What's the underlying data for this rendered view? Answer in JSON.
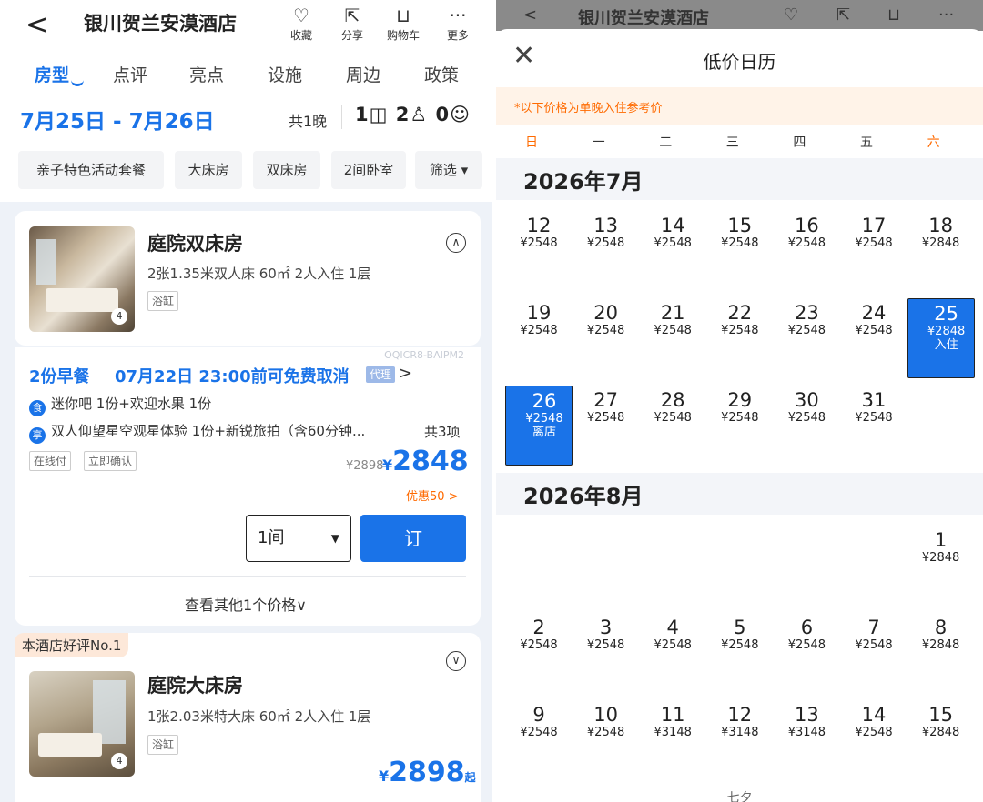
{
  "left": {
    "header": {
      "back": "<",
      "title": "银川贺兰安漠酒店",
      "actions": [
        {
          "icon": "heart-icon",
          "glyph": "♡",
          "label": "收藏"
        },
        {
          "icon": "share-icon",
          "glyph": "⇱",
          "label": "分享"
        },
        {
          "icon": "cart-icon",
          "glyph": "🛒",
          "label": "购物车"
        },
        {
          "icon": "more-icon",
          "glyph": "···",
          "label": "更多"
        }
      ]
    },
    "tabs": [
      "房型",
      "点评",
      "亮点",
      "设施",
      "周边",
      "政策"
    ],
    "dates": "7月25日 - 7月26日",
    "nights": "共1晚",
    "guests": "1 2 0",
    "chips": [
      "亲子特色活动套餐",
      "大床房",
      "双床房",
      "2间卧室",
      "筛选 ▾"
    ],
    "room1": {
      "name": "庭院双床房",
      "desc": "2张1.35米双人床 60㎡ 2人入住 1层",
      "tag": "浴缸",
      "img_count": "4",
      "code": "OQICR8-BAIPM2",
      "breakfast": "2份早餐",
      "cancel": "07月22日 23:00前可免费取消",
      "agent": "代理",
      "agent_arrow": ">",
      "perk1_icon": "食",
      "perk1": "迷你吧 1份+欢迎水果 1份",
      "perk2_icon": "享",
      "perk2": "双人仰望星空观星体验 1份+新锐旅拍（含60分钟...",
      "perk_total": "共3项",
      "tags": [
        "在线付",
        "立即确认"
      ],
      "old_price": "¥2898",
      "currency": "¥",
      "price": "2848",
      "discount": "优惠50 >",
      "qty": "1间",
      "book": "订",
      "more_prices": "查看其他1个价格∨"
    },
    "room2": {
      "badge": "本酒店好评No.1",
      "name": "庭院大床房",
      "desc": "1张2.03米特大床 60㎡ 2人入住 1层",
      "tag": "浴缸",
      "img_count": "4",
      "currency": "¥",
      "price": "2898",
      "suffix": "起"
    }
  },
  "right": {
    "bg_title": "银川贺兰安漠酒店",
    "title": "低价日历",
    "notice": "*以下价格为单晚入住参考价",
    "weekdays": [
      "日",
      "一",
      "二",
      "三",
      "四",
      "五",
      "六"
    ],
    "months": [
      {
        "label": "2026年7月",
        "rows": [
          [
            {
              "d": "12",
              "p": "¥2548"
            },
            {
              "d": "13",
              "p": "¥2548"
            },
            {
              "d": "14",
              "p": "¥2548"
            },
            {
              "d": "15",
              "p": "¥2548"
            },
            {
              "d": "16",
              "p": "¥2548"
            },
            {
              "d": "17",
              "p": "¥2548"
            },
            {
              "d": "18",
              "p": "¥2848"
            }
          ],
          [
            {
              "d": "19",
              "p": "¥2548"
            },
            {
              "d": "20",
              "p": "¥2548"
            },
            {
              "d": "21",
              "p": "¥2548"
            },
            {
              "d": "22",
              "p": "¥2548"
            },
            {
              "d": "23",
              "p": "¥2548"
            },
            {
              "d": "24",
              "p": "¥2548"
            },
            {
              "d": "25",
              "p": "¥2848",
              "note": "入住",
              "selected": true
            }
          ],
          [
            {
              "d": "26",
              "p": "¥2548",
              "note": "离店",
              "selected": true
            },
            {
              "d": "27",
              "p": "¥2548"
            },
            {
              "d": "28",
              "p": "¥2548"
            },
            {
              "d": "29",
              "p": "¥2548"
            },
            {
              "d": "30",
              "p": "¥2548"
            },
            {
              "d": "31",
              "p": "¥2548"
            },
            null
          ]
        ]
      },
      {
        "label": "2026年8月",
        "rows": [
          [
            null,
            null,
            null,
            null,
            null,
            null,
            {
              "d": "1",
              "p": "¥2848"
            }
          ],
          [
            {
              "d": "2",
              "p": "¥2548"
            },
            {
              "d": "3",
              "p": "¥2548"
            },
            {
              "d": "4",
              "p": "¥2548"
            },
            {
              "d": "5",
              "p": "¥2548"
            },
            {
              "d": "6",
              "p": "¥2548"
            },
            {
              "d": "7",
              "p": "¥2548"
            },
            {
              "d": "8",
              "p": "¥2848"
            }
          ],
          [
            {
              "d": "9",
              "p": "¥2548"
            },
            {
              "d": "10",
              "p": "¥2548"
            },
            {
              "d": "11",
              "p": "¥3148"
            },
            {
              "d": "12",
              "p": "¥3148"
            },
            {
              "d": "13",
              "p": "¥3148"
            },
            {
              "d": "14",
              "p": "¥2548"
            },
            {
              "d": "15",
              "p": "¥2848"
            }
          ]
        ]
      }
    ],
    "footer_hint": "七夕"
  }
}
